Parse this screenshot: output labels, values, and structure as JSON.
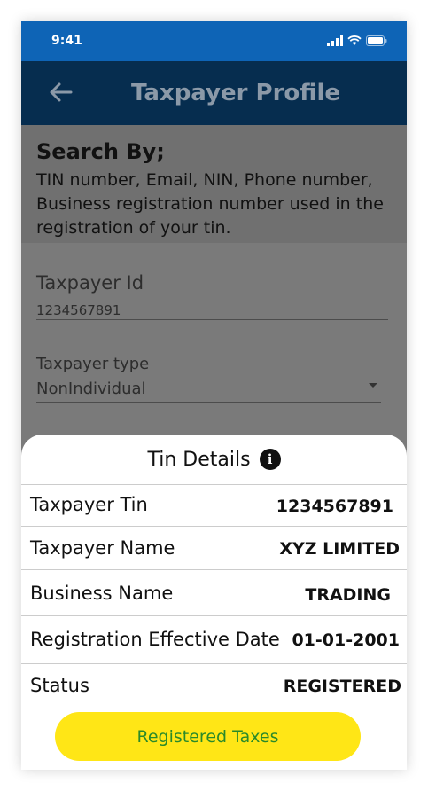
{
  "status_bar": {
    "time": "9:41"
  },
  "app_bar": {
    "title": "Taxpayer Profile"
  },
  "search": {
    "title": "Search By;",
    "description": "TIN number, Email, NIN, Phone number, Business registration number used in the registration of your tin."
  },
  "form": {
    "taxpayer_id_label": "Taxpayer Id",
    "taxpayer_id_value": "1234567891",
    "taxpayer_type_label": "Taxpayer type",
    "taxpayer_type_value": "NonIndividual"
  },
  "sheet": {
    "title": "Tin Details",
    "rows": [
      {
        "label": "Taxpayer Tin",
        "value": "1234567891"
      },
      {
        "label": "Taxpayer Name",
        "value": "XYZ LIMITED"
      },
      {
        "label": "Business Name",
        "value": "TRADING"
      },
      {
        "label": "Registration Effective Date",
        "value": "01-01-2001"
      },
      {
        "label": "Status",
        "value": "REGISTERED"
      }
    ],
    "button_label": "Registered Taxes"
  },
  "colors": {
    "status_bar": "#0e64b6",
    "app_bar": "#062d4f",
    "button": "#ffe616",
    "button_text": "#2a8a2a"
  }
}
